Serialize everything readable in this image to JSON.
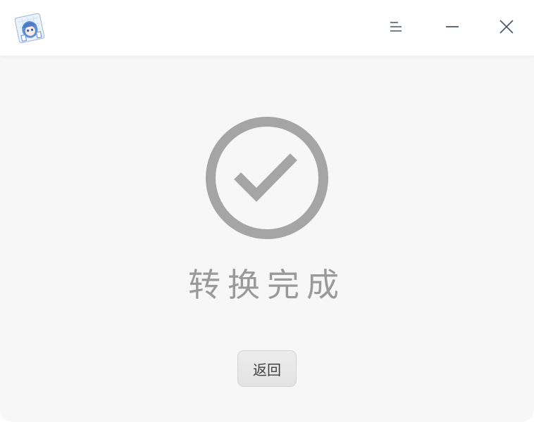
{
  "titlebar": {
    "app_icon": "anime-character-app-icon",
    "buttons": {
      "menu_icon": "menu-icon",
      "minimize_icon": "minimize-icon",
      "close_icon": "close-icon"
    }
  },
  "main": {
    "status_icon": "check-circle-icon",
    "status_text": "转换完成",
    "back_button_label": "返回"
  },
  "colors": {
    "titlebar_bg": "#ffffff",
    "content_bg": "#f7f7f7",
    "icon_gray": "#a5a5a5",
    "text_gray": "#9a9a9a",
    "button_bg": "#e6e6e6"
  }
}
